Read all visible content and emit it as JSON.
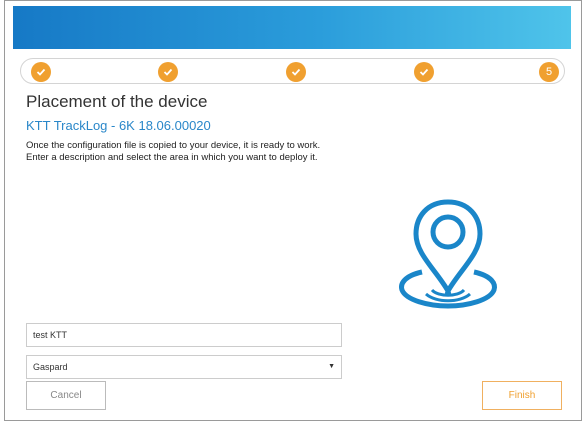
{
  "header": {
    "brand_color": "#1f8dd6"
  },
  "stepper": {
    "steps": [
      {
        "state": "done",
        "icon": "check-icon"
      },
      {
        "state": "done",
        "icon": "check-icon"
      },
      {
        "state": "done",
        "icon": "check-icon"
      },
      {
        "state": "done",
        "icon": "check-icon"
      },
      {
        "state": "current",
        "label": "5"
      }
    ],
    "accent_color": "#f0a030"
  },
  "main": {
    "title": "Placement of the device",
    "subtitle": "KTT TrackLog - 6K 18.06.00020",
    "description_line1": "Once the configuration file is copied to your device, it is ready to work.",
    "description_line2": "Enter a description and select the area in which you want to deploy it.",
    "illustration": "location-pin-icon"
  },
  "form": {
    "description_value": "test KTT",
    "area_value": "Gaspard"
  },
  "buttons": {
    "cancel_label": "Cancel",
    "finish_label": "Finish"
  }
}
